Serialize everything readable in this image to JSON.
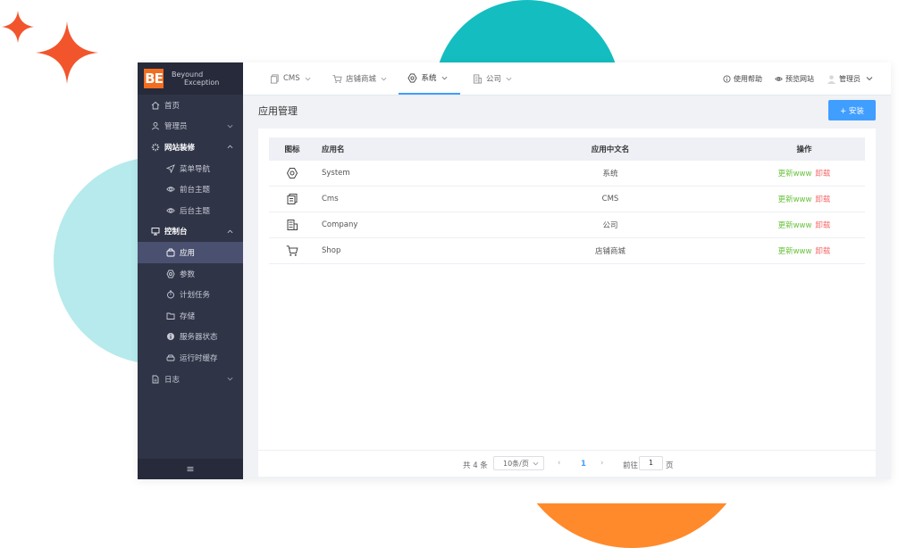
{
  "logo": {
    "mark": "BE",
    "line1": "Beyound",
    "line2": "Exception"
  },
  "sidebar": {
    "items": [
      {
        "label": "首页",
        "icon": "home-icon"
      },
      {
        "label": "管理员",
        "icon": "user-icon"
      },
      {
        "label": "网站装修",
        "icon": "magic-icon"
      },
      {
        "label": "菜单导航",
        "icon": "send-icon"
      },
      {
        "label": "前台主题",
        "icon": "eye-icon"
      },
      {
        "label": "后台主题",
        "icon": "eye-icon"
      },
      {
        "label": "控制台",
        "icon": "monitor-icon"
      },
      {
        "label": "应用",
        "icon": "box-icon"
      },
      {
        "label": "参数",
        "icon": "gear-icon"
      },
      {
        "label": "计划任务",
        "icon": "timer-icon"
      },
      {
        "label": "存储",
        "icon": "folder-icon"
      },
      {
        "label": "服务器状态",
        "icon": "info-icon"
      },
      {
        "label": "运行时缓存",
        "icon": "drive-icon"
      },
      {
        "label": "日志",
        "icon": "document-icon"
      }
    ],
    "footer": "≡"
  },
  "topbar": {
    "tabs": [
      {
        "label": "CMS",
        "icon": "copy-icon"
      },
      {
        "label": "店铺商城",
        "icon": "cart-icon"
      },
      {
        "label": "系统",
        "icon": "gear-icon"
      },
      {
        "label": "公司",
        "icon": "building-icon"
      }
    ],
    "help": "使用帮助",
    "preview": "预览网站",
    "admin": "管理员"
  },
  "page": {
    "title": "应用管理",
    "install_label": "+ 安装"
  },
  "table": {
    "headers": [
      "图标",
      "应用名",
      "应用中文名",
      "操作"
    ],
    "rows": [
      {
        "icon": "gear-icon",
        "name": "System",
        "cn_name": "系统"
      },
      {
        "icon": "copy-icon",
        "name": "Cms",
        "cn_name": "CMS"
      },
      {
        "icon": "building-icon",
        "name": "Company",
        "cn_name": "公司"
      },
      {
        "icon": "cart-icon",
        "name": "Shop",
        "cn_name": "店铺商城"
      }
    ],
    "action_update": "更新www",
    "action_uninstall": "卸载"
  },
  "pager": {
    "total": "共 4 条",
    "page_size": "10条/页",
    "prev": "‹",
    "current": "1",
    "next": "›",
    "goto": "前往",
    "goto_value": "1",
    "page_suffix": "页"
  },
  "colors": {
    "accent": "#409eff",
    "sidebar": "#2f3447",
    "update": "#67c23a",
    "uninstall": "#f56c6c",
    "logo": "#f36d21"
  }
}
